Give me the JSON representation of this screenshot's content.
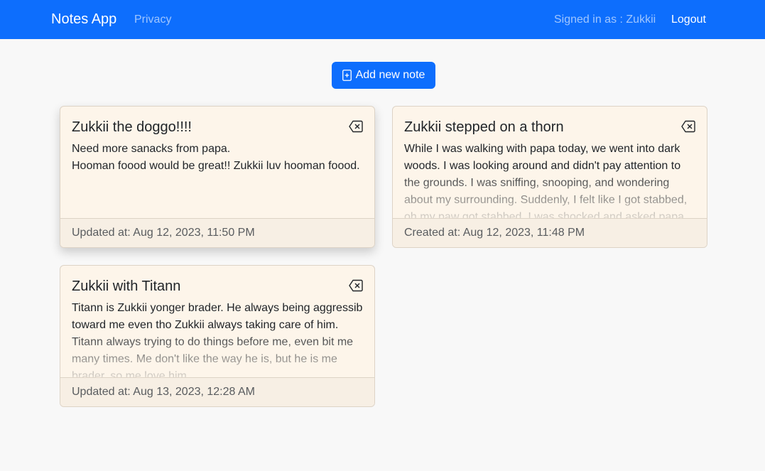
{
  "navbar": {
    "brand": "Notes App",
    "privacy": "Privacy",
    "signed_in": "Signed in as : Zukkii",
    "logout": "Logout"
  },
  "add_button": {
    "label": "Add new note",
    "icon": "file-plus-icon"
  },
  "notes": [
    {
      "title": "Zukkii the doggo!!!!",
      "body": "Need more sanacks from papa.\nHooman foood would be great!! Zukkii luv hooman foood.",
      "footer": "Updated at: Aug 12, 2023, 11:50 PM",
      "icon": "backspace-delete-icon"
    },
    {
      "title": "Zukkii stepped on a thorn",
      "body": "While I was walking with papa today, we went into dark woods. I was looking around and didn't pay attention to the grounds. I was sniffing, snooping, and wondering about my surrounding. Suddenly, I felt like I got stabbed, oh my paw got stabbed. I was shocked and asked papa",
      "footer": "Created at: Aug 12, 2023, 11:48 PM",
      "icon": "backspace-delete-icon"
    },
    {
      "title": "Zukkii with Titann",
      "body": "Titann is Zukkii yonger brader. He always being aggressib toward me even tho Zukkii always taking care of him. Titann always trying to do things before me, even bit me many times. Me don't like the way he is, but he is me brader, so me love him.",
      "footer": "Updated at: Aug 13, 2023, 12:28 AM",
      "icon": "backspace-delete-icon"
    }
  ],
  "colors": {
    "primary": "#0d6efd",
    "background": "#f8f8f8",
    "card_background": "#fdf5ea",
    "card_footer": "#f7efe4"
  }
}
